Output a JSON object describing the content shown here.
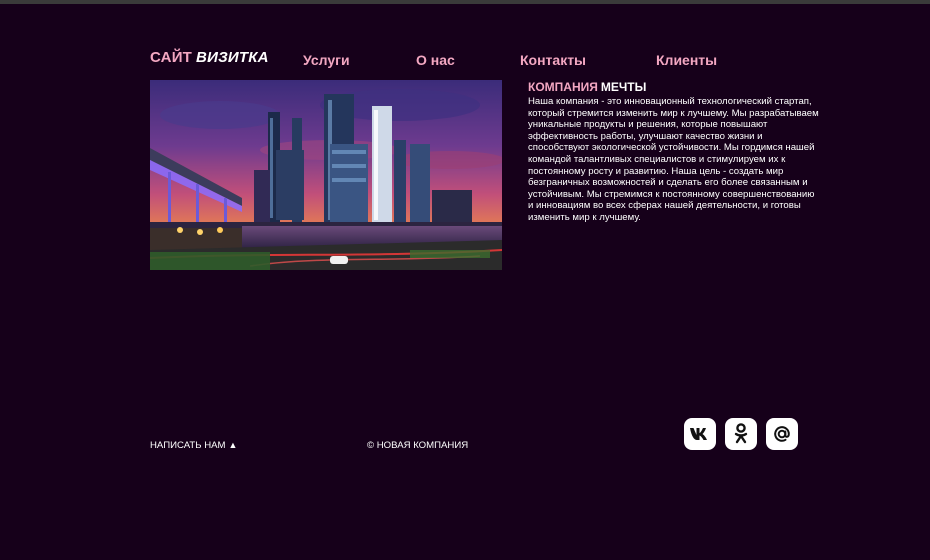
{
  "header": {
    "logo_part1": "САЙТ",
    "logo_part2": "ВИЗИТКА",
    "nav": [
      "Услуги",
      "О нас",
      "Контакты",
      "Клиенты"
    ]
  },
  "about": {
    "title_part1": "КОМПАНИЯ",
    "title_part2": "МЕЧТЫ",
    "text": "Наша компания - это инновационный технологический стартап, который стремится изменить мир к лучшему. Мы разрабатываем уникальные продукты и решения, которые повышают эффективность работы, улучшают качество жизни и способствуют экологической устойчивости. Мы гордимся нашей командой талантливых специалистов и стимулируем их к постоянному росту и развитию. Наша цель - создать мир безграничных возможностей и сделать его более связанным и устойчивым. Мы стремимся к постоянному совершенствованию и инновациям во всех сферах нашей деятельности, и готовы изменить мир к лучшему."
  },
  "footer": {
    "write_us": "НАПИСАТЬ НАМ",
    "write_us_arrow": "▲",
    "copyright": "© НОВАЯ КОМПАНИЯ"
  },
  "social": [
    "vk-icon",
    "odnoklassniki-icon",
    "email-icon"
  ],
  "colors": {
    "background": "#16001a",
    "accent": "#f3a7c2",
    "text": "#ffffff"
  }
}
